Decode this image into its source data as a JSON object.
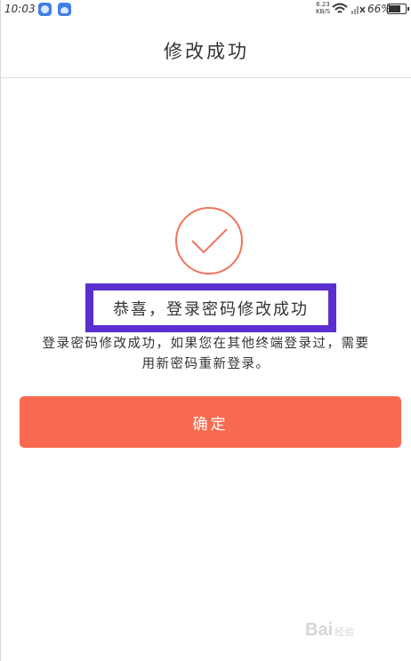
{
  "status_bar": {
    "time": "10:03",
    "net_speed_value": "6.23",
    "net_speed_unit": "KB/S",
    "battery": "66%",
    "icons": [
      "app-icon-blue",
      "cloud-icon",
      "wifi-icon",
      "signal-icon",
      "battery-icon"
    ]
  },
  "nav": {
    "title": "修改成功"
  },
  "content": {
    "success_title": "恭喜，登录密码修改成功",
    "description": "登录密码修改成功，如果您在其他终端登录过，需要用新密码重新登录。",
    "confirm_label": "确定",
    "icon": "check-circle-icon"
  },
  "watermark": {
    "text": "Bai",
    "suffix": "经验"
  },
  "colors": {
    "accent": "#f86a50",
    "highlight_border": "#5a2ecf",
    "text": "#333333"
  }
}
